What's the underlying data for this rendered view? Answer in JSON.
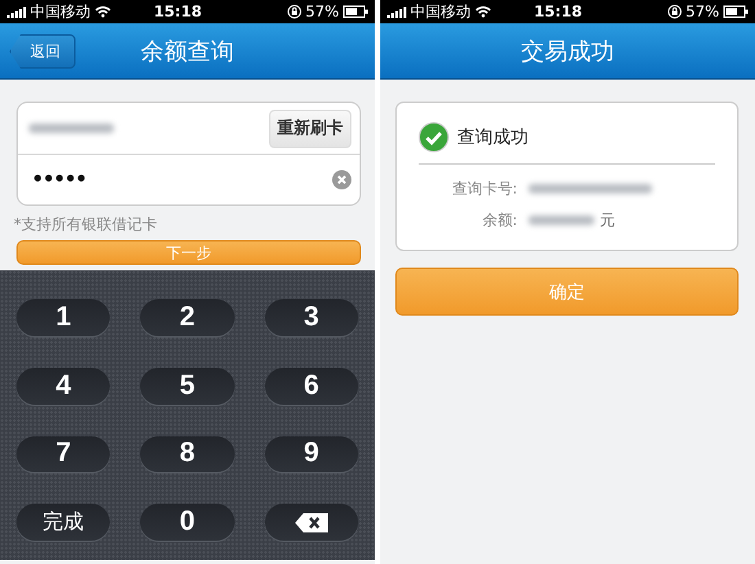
{
  "screens": [
    {
      "status_bar": {
        "carrier": "中国移动",
        "time": "15:18",
        "battery": "57%"
      },
      "header": {
        "title": "余额查询",
        "back_button": "返回"
      },
      "form": {
        "swipe_button": "重新刷卡",
        "password_value": "•••••",
        "note": "*支持所有银联借记卡",
        "next_button": "下一步"
      },
      "keypad": [
        {
          "kind": "digit",
          "label": "1"
        },
        {
          "kind": "digit",
          "label": "2"
        },
        {
          "kind": "digit",
          "label": "3"
        },
        {
          "kind": "digit",
          "label": "4"
        },
        {
          "kind": "digit",
          "label": "5"
        },
        {
          "kind": "digit",
          "label": "6"
        },
        {
          "kind": "digit",
          "label": "7"
        },
        {
          "kind": "digit",
          "label": "8"
        },
        {
          "kind": "digit",
          "label": "9"
        },
        {
          "kind": "text",
          "label": "完成"
        },
        {
          "kind": "digit",
          "label": "0"
        },
        {
          "kind": "delete"
        }
      ]
    },
    {
      "status_bar": {
        "carrier": "中国移动",
        "time": "15:18",
        "battery": "57%"
      },
      "header": {
        "title": "交易成功"
      },
      "result": {
        "title": "查询成功",
        "card_label": "查询卡号:",
        "balance_label": "余额:",
        "currency": "元",
        "confirm_button": "确定"
      }
    }
  ]
}
